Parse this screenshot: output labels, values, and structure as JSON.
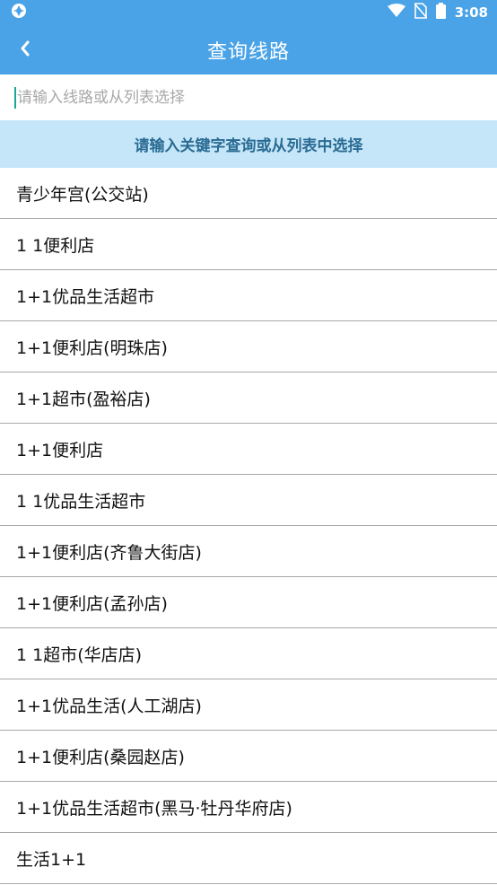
{
  "status_bar": {
    "time": "3:08"
  },
  "app_bar": {
    "title": "查询线路"
  },
  "search": {
    "placeholder": "请输入线路或从列表选择",
    "value": ""
  },
  "hint": {
    "text": "请输入关键字查询或从列表中选择"
  },
  "list": {
    "items": [
      "青少年宫(公交站)",
      "1 1便利店",
      "1+1优品生活超市",
      "1+1便利店(明珠店)",
      "1+1超市(盈裕店)",
      "1+1便利店",
      "1 1优品生活超市",
      "1+1便利店(齐鲁大街店)",
      "1+1便利店(孟孙店)",
      "1 1超市(华店店)",
      "1+1优品生活(人工湖店)",
      "1+1便利店(桑园赵店)",
      "1+1优品生活超市(黑马·牡丹华府店)",
      "生活1+1"
    ]
  },
  "colors": {
    "primary": "#4aa3e6",
    "hint_bg": "#c4e6f8",
    "hint_text": "#2a6b93",
    "divider": "#a9a9a9"
  }
}
